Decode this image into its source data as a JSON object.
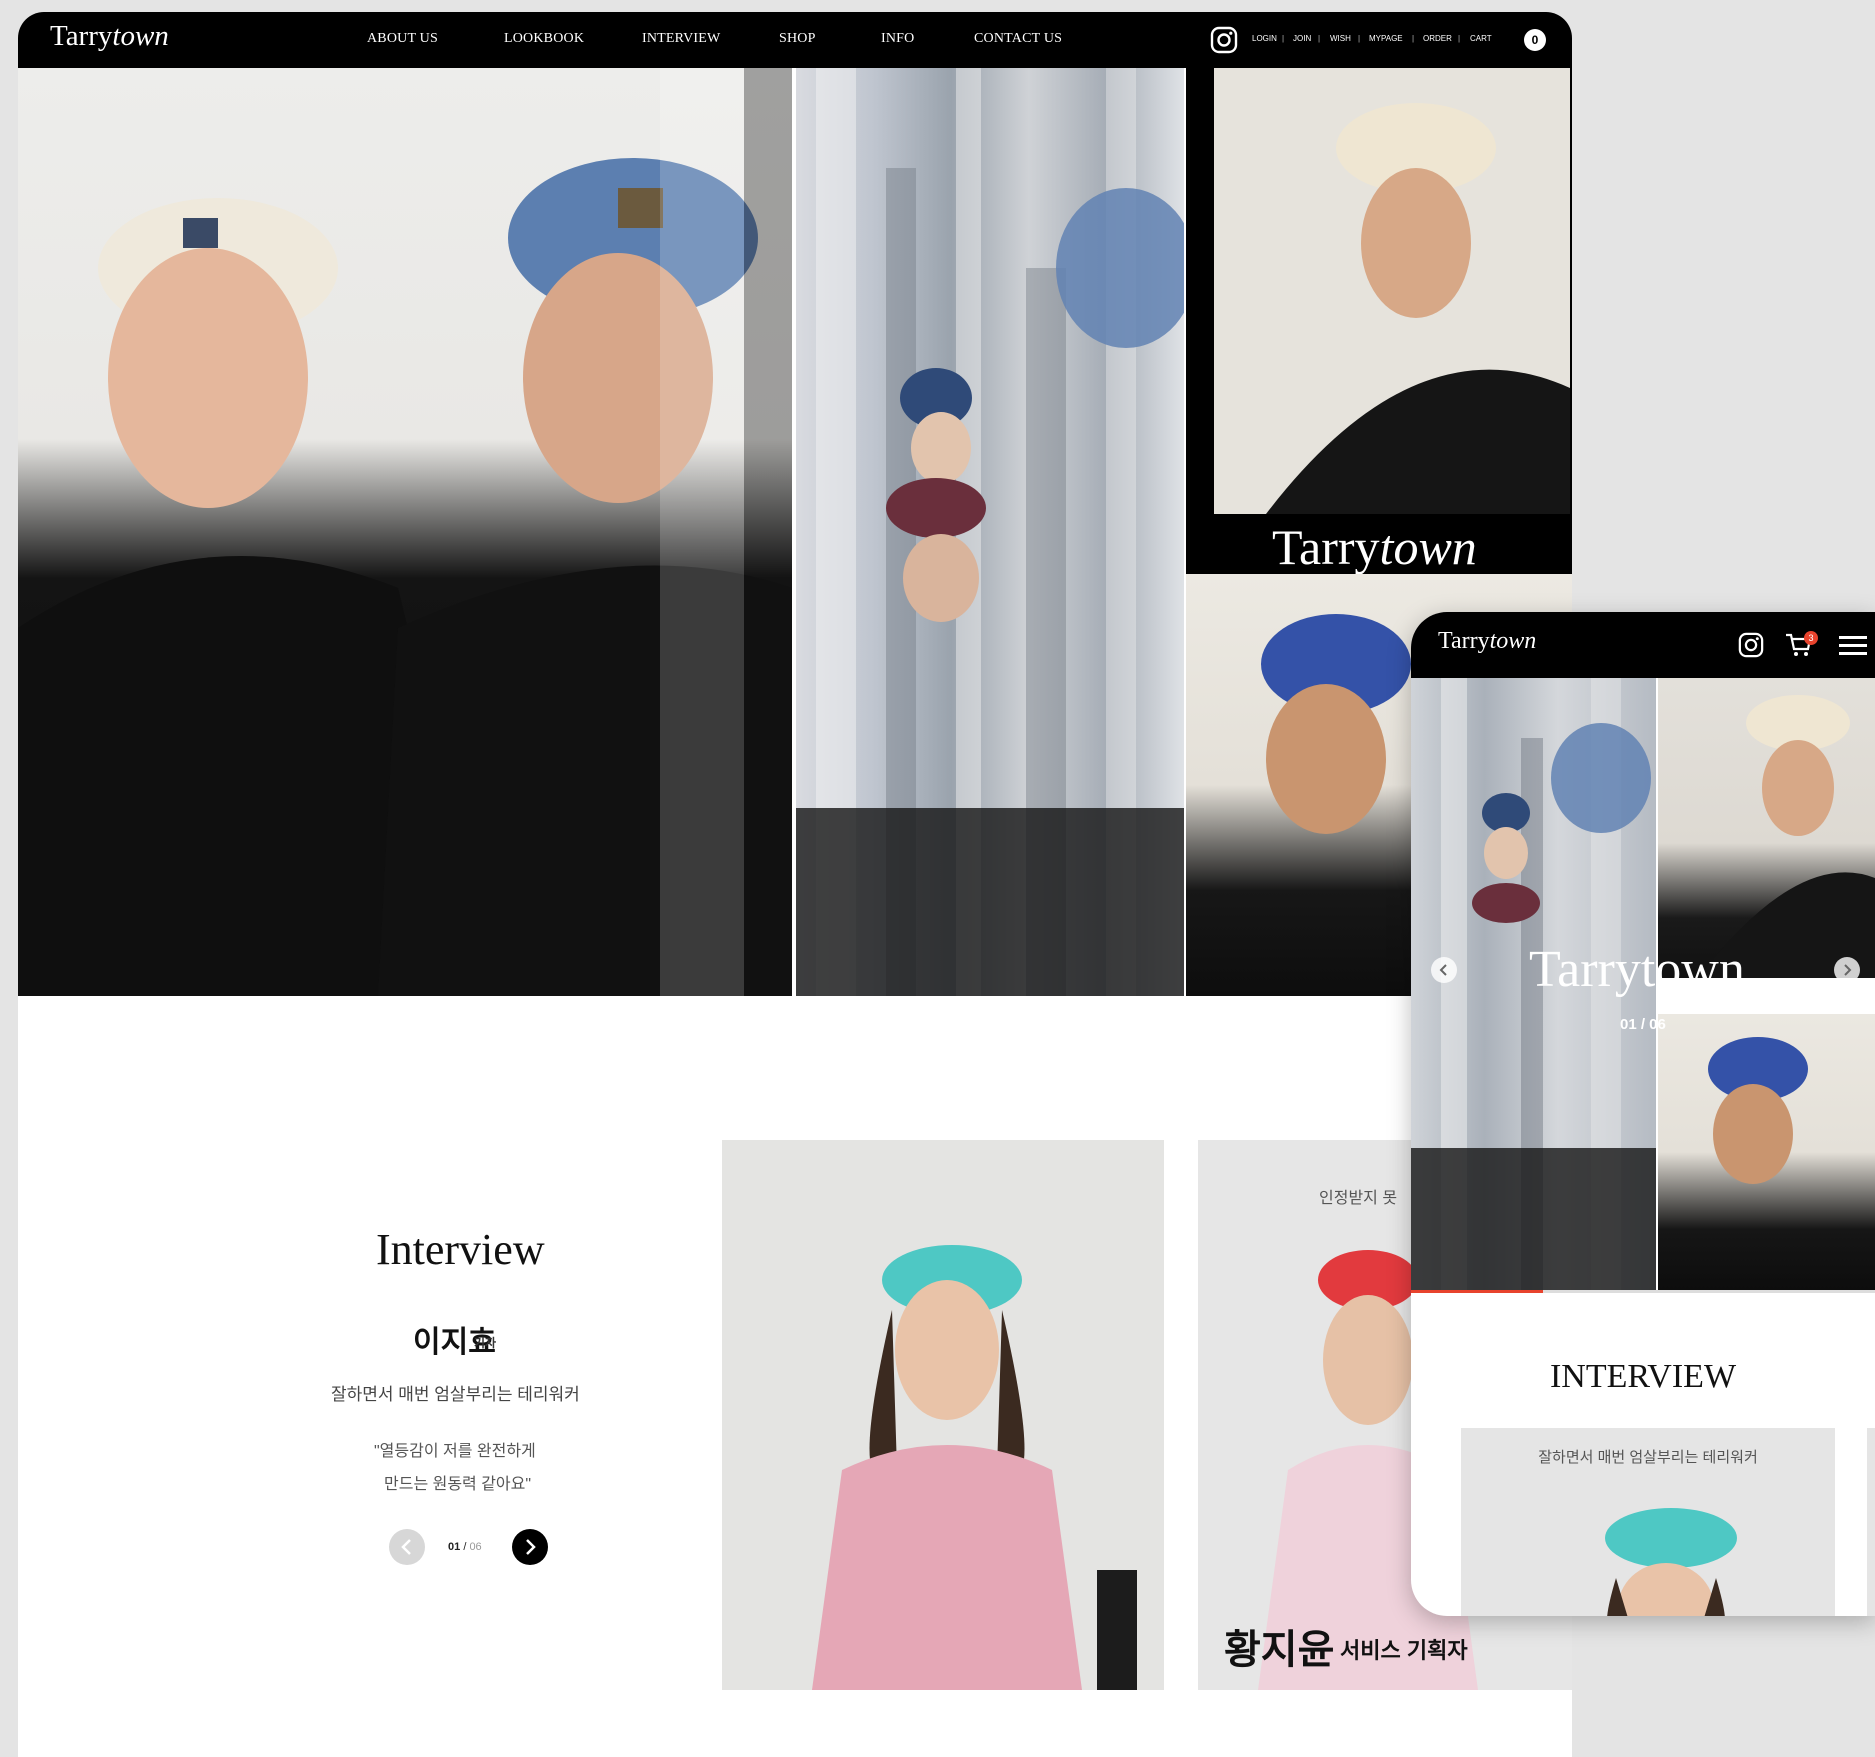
{
  "brand": {
    "name_regular": "Tarry",
    "name_italic": "town"
  },
  "nav": {
    "links": [
      "ABOUT US",
      "LOOKBOOK",
      "INTERVIEW",
      "SHOP",
      "INFO",
      "CONTACT US"
    ],
    "utility": [
      "LOGIN",
      "JOIN",
      "WISH",
      "MYPAGE",
      "ORDER",
      "CART"
    ],
    "separator": "|",
    "cart_count": "0",
    "instagram_icon": "instagram-icon"
  },
  "hero": {
    "overlay_logo_regular": "Tarry",
    "overlay_logo_italic": "town"
  },
  "interview": {
    "title": "Interview",
    "name": "이지효",
    "role": "기자",
    "subtitle": "잘하면서 매번 엄살부리는 테리워커",
    "quote_line1": "\"열등감이 저를 완전하게",
    "quote_line2": "만드는 원동력 같아요\"",
    "counter_current": "01",
    "counter_sep": "/",
    "counter_total": "06",
    "card2_quote": "인정받지 못",
    "card2_name": "황지윤",
    "card2_role": "서비스 기획자"
  },
  "mobile": {
    "cart_badge": "3",
    "big_logo": "Tarrytown",
    "small_logo": "Tarrytown",
    "counter": "01 / 06",
    "interview_title": "INTERVIEW",
    "card_subtitle": "잘하면서 매번 엄살부리는 테리워커"
  },
  "colors": {
    "accent": "#e8432d",
    "nav_bg": "#000000",
    "page_bg": "#e4e4e4"
  }
}
